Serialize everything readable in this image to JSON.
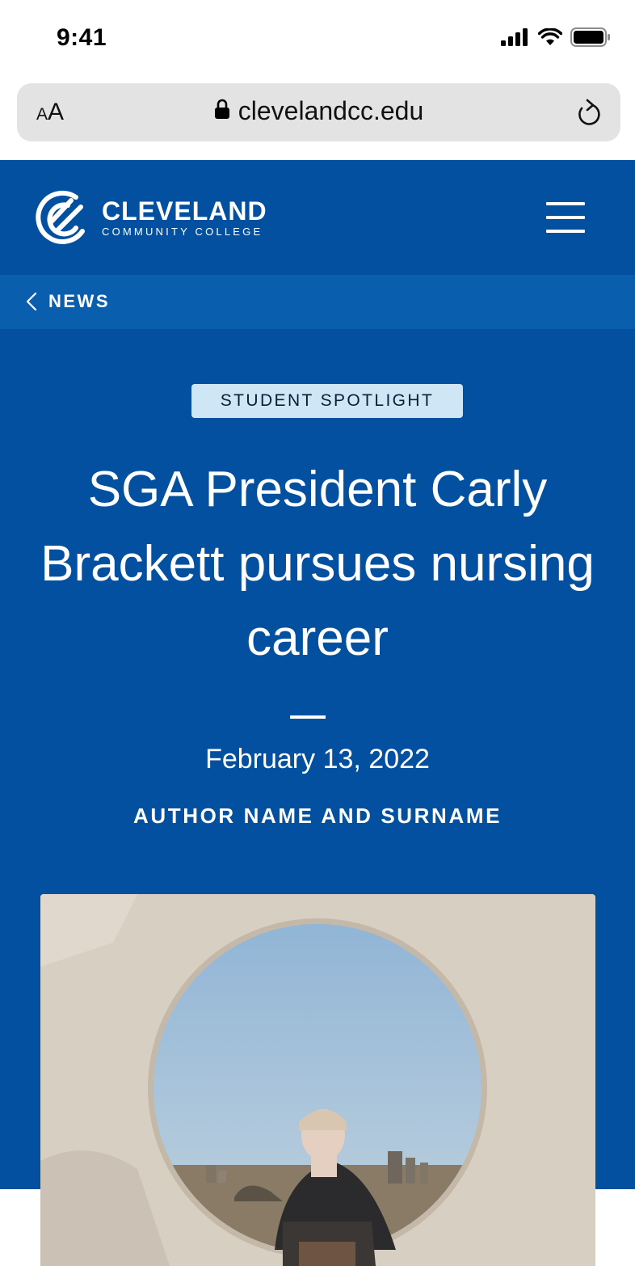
{
  "status_bar": {
    "time": "9:41"
  },
  "browser": {
    "text_size_label": "AA",
    "url": "clevelandcc.edu"
  },
  "header": {
    "logo_title": "CLEVELAND",
    "logo_subtitle": "COMMUNITY COLLEGE",
    "brand_color": "#02509f"
  },
  "breadcrumb": {
    "back_label": "NEWS"
  },
  "article": {
    "category": "STUDENT SPOTLIGHT",
    "title": "SGA President Carly Brackett pursues nursing career",
    "date": "February 13, 2022",
    "author": "AUTHOR NAME AND SURNAME"
  },
  "colors": {
    "header_bg": "#02509f",
    "breadcrumb_bg": "#0a5eae",
    "badge_bg": "#cfe6f7",
    "address_bar_bg": "#e3e3e4"
  }
}
